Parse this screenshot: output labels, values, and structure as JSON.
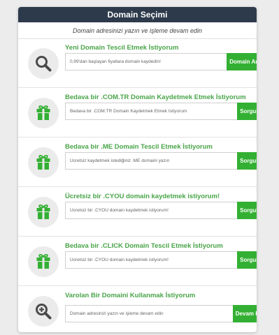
{
  "header": {
    "title": "Domain Seçimi"
  },
  "subtitle": "Domain adresinizi yazın ve işleme devam edin",
  "options": [
    {
      "title": "Yeni Domain Tescil Etmek İstiyorum",
      "placeholder": "0,99'dan başlayan fiyatlara domain kaydedin!",
      "button": "Domain Ara",
      "icon": "search-icon"
    },
    {
      "title": "Bedava bir .COM.TR Domain Kaydetmek Etmek İstiyorum",
      "placeholder": "Bedava bir .COM.TR Domain Kaydetmek Etmek İstiyorum",
      "button": "Sorgula",
      "icon": "gift-icon"
    },
    {
      "title": "Bedava bir .ME Domain Tescil Etmek İstiyorum",
      "placeholder": "Ücretsiz kaydetmek istediğiniz .ME domaini yazın",
      "button": "Sorgula",
      "icon": "gift-icon"
    },
    {
      "title": "Ücretsiz bir .CYOU domain kaydetmek istiyorum!",
      "placeholder": "Ücretsiz bir .CYOU domain kaydetmek istiyorum!",
      "button": "Sorgula",
      "icon": "gift-icon"
    },
    {
      "title": "Bedava bir .CLICK Domain Tescil Etmek İstiyorum",
      "placeholder": "Ücretsiz bir .CYOU domain kaydetmek istiyorum!",
      "button": "Sorgula",
      "icon": "gift-icon"
    },
    {
      "title": "Varolan Bir Domaini Kullanmak İstiyorum",
      "placeholder": "Domain adresinizi yazın ve işleme devam edin",
      "button": "Devam Et",
      "icon": "zoom-in-icon"
    }
  ],
  "colors": {
    "header_bg": "#2d3a4b",
    "accent_green": "#33b033",
    "title_green": "#48a448",
    "icon_dark": "#4a4a4a"
  }
}
